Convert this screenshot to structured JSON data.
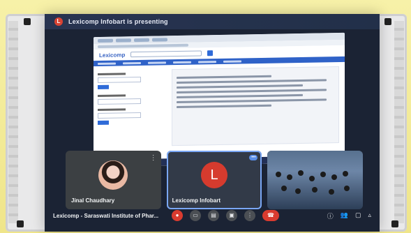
{
  "banner": {
    "presenter_initial": "L",
    "presenting_text": "Lexicomp Infobart is presenting"
  },
  "shared_screen": {
    "logo_text": "Lexicomp"
  },
  "participants": [
    {
      "name": "Jinal Chaudhary"
    },
    {
      "name": "Lexicomp Infobart",
      "initial": "L"
    }
  ],
  "meeting": {
    "name": "Lexicomp - Saraswati Institute of Phar..."
  },
  "icons": {
    "mic": "microphone-icon",
    "cam": "camera-icon",
    "captions": "captions-icon",
    "present": "present-icon",
    "more": "more-vert-icon",
    "end": "end-call-icon",
    "info": "info-icon",
    "people": "people-icon",
    "chat": "chat-icon",
    "activities": "activities-icon"
  },
  "colors": {
    "meet_red": "#d93b2f",
    "active_border": "#7aa7f5"
  }
}
